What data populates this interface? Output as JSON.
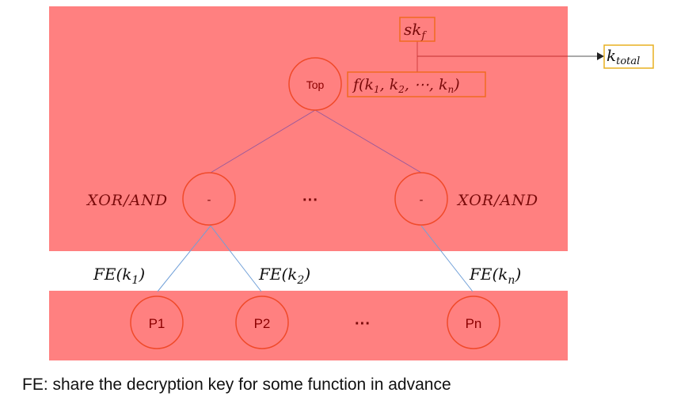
{
  "colors": {
    "panel_fill": "#ff8080",
    "node_stroke": "#f04a2a",
    "node_text": "#8b0000",
    "math_text_dark": "#7a0a0a",
    "edge_upper": "#9b5a9b",
    "edge_lower": "#6f9fd8",
    "box_orange": "#f06a20",
    "box_gold": "#e8b020",
    "arrow": "#555555"
  },
  "nodes": {
    "top": {
      "label": "Top"
    },
    "mid_left": {
      "label": "-",
      "gate_label": "XOR/AND"
    },
    "mid_ellipsis": "···",
    "mid_right": {
      "label": "-",
      "gate_label": "XOR/AND"
    },
    "parties": [
      {
        "label": "P1"
      },
      {
        "label": "P2"
      },
      {
        "label": "Pn"
      }
    ],
    "party_ellipsis": "···"
  },
  "boxes": {
    "secret_key": {
      "base": "sk",
      "sub": "f"
    },
    "function": {
      "text": "f(k",
      "parts": [
        "f(k",
        "1",
        ", k",
        "2",
        ", ⋯, k",
        "n",
        ")"
      ]
    },
    "output": {
      "base": "k",
      "sub": "total"
    }
  },
  "edge_labels": [
    {
      "base": "FE(k",
      "sub": "1",
      "close": ")"
    },
    {
      "base": "FE(k",
      "sub": "2",
      "close": ")"
    },
    {
      "base": "FE(k",
      "sub": "n",
      "close": ")"
    }
  ],
  "caption": "FE: share the decryption key for some function in advance"
}
